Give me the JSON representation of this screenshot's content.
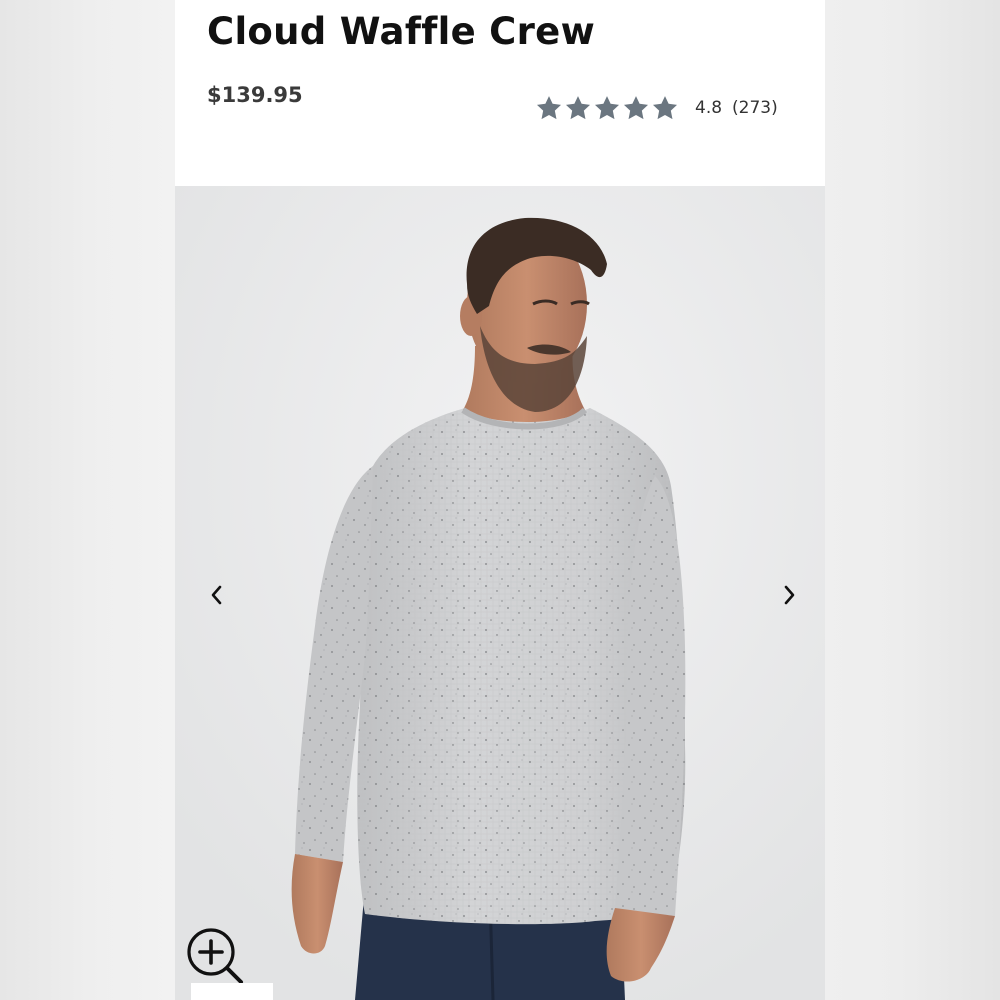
{
  "product": {
    "title": "Cloud Waffle Crew",
    "price": "$139.95",
    "rating": {
      "value": "4.8",
      "count": "(273)",
      "stars": 5,
      "star_color": "#6b7680"
    }
  },
  "gallery": {
    "prev_icon": "chevron-left-icon",
    "next_icon": "chevron-right-icon",
    "zoom_icon": "zoom-in-icon",
    "image_subject": "man-wearing-grey-waffle-crew-sweater"
  },
  "colors": {
    "title": "#111111",
    "price": "#3a3a3a",
    "sweater": "#c9cacc",
    "background": "#ebebec"
  }
}
